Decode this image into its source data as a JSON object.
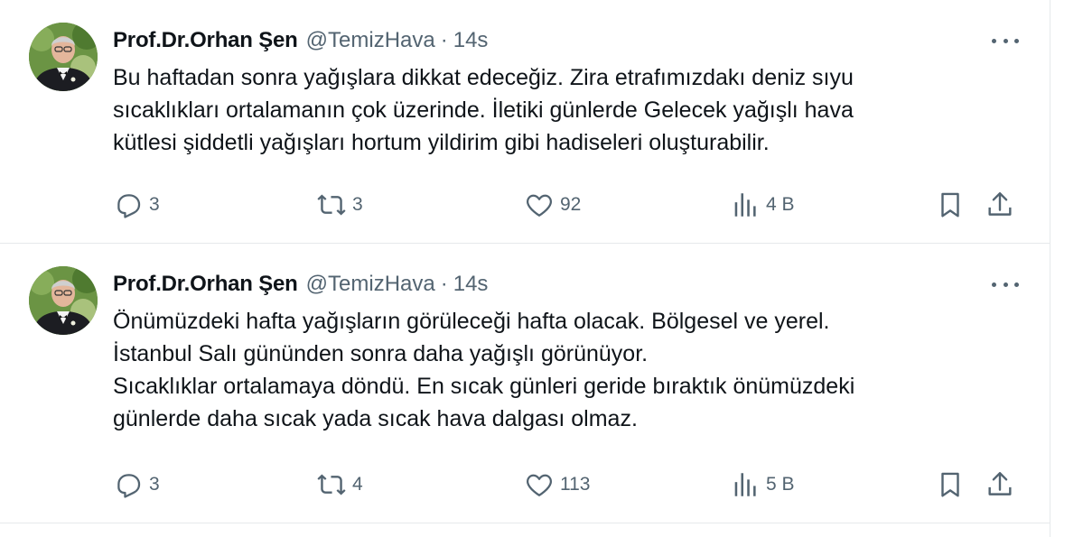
{
  "tweets": [
    {
      "author_name": "Prof.Dr.Orhan Şen",
      "handle": "@TemizHava",
      "separator": "·",
      "timestamp": "14s",
      "text_lines": [
        "Bu haftadan sonra yağışlara dikkat edeceğiz. Zira etrafımızdakı deniz sıyu",
        "sıcaklıkları ortalamanın çok üzerinde. İletiki günlerde Gelecek yağışlı hava",
        "kütlesi şiddetli yağışları hortum yildirim gibi hadiseleri oluşturabilir."
      ],
      "replies": "3",
      "reposts": "3",
      "likes": "92",
      "views": "4 B"
    },
    {
      "author_name": "Prof.Dr.Orhan Şen",
      "handle": "@TemizHava",
      "separator": "·",
      "timestamp": "14s",
      "text_lines": [
        "Önümüzdeki hafta yağışların görüleceği hafta olacak. Bölgesel ve yerel.",
        "İstanbul Salı gününden sonra daha yağışlı görünüyor.",
        "Sıcaklıklar ortalamaya döndü. En sıcak günleri geride bıraktık önümüzdeki",
        "günlerde daha sıcak yada sıcak hava dalgası olmaz."
      ],
      "replies": "3",
      "reposts": "4",
      "likes": "113",
      "views": "5 B"
    }
  ],
  "icons": {
    "reply": "reply-icon",
    "repost": "repost-icon",
    "like": "heart-icon",
    "views": "analytics-icon",
    "bookmark": "bookmark-icon",
    "share": "share-icon",
    "more": "more-icon"
  },
  "colors": {
    "text_primary": "#0f1419",
    "text_secondary": "#536471",
    "divider": "#e6e9eb"
  }
}
